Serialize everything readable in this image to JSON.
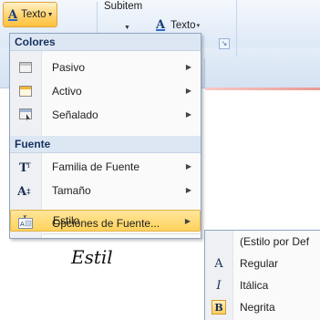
{
  "ribbon": {
    "texto_button_label": "Texto",
    "subitem_label": "Subitem",
    "texto2_label": "Texto"
  },
  "menu": {
    "sections": [
      {
        "header": "Colores",
        "items": [
          {
            "label": "Pasivo",
            "icon": "passive-color-icon"
          },
          {
            "label": "Activo",
            "icon": "active-color-icon"
          },
          {
            "label": "Señalado",
            "icon": "highlighted-color-icon"
          }
        ]
      },
      {
        "header": "Fuente",
        "items": [
          {
            "label": "Familia de Fuente",
            "icon": "font-family-icon"
          },
          {
            "label": "Tamaño",
            "icon": "font-size-icon"
          },
          {
            "label": "Estilo",
            "icon": "font-style-icon",
            "active": true
          }
        ]
      }
    ],
    "footer_item": {
      "label": "Opciones de Fuente...",
      "icon": "font-options-icon"
    }
  },
  "submenu": {
    "items": [
      {
        "label": "(Estilo por Def",
        "icon": ""
      },
      {
        "label": "Regular",
        "icon": "regular-a-icon"
      },
      {
        "label": "Itálica",
        "icon": "italic-i-icon"
      },
      {
        "label": "Negrita",
        "icon": "bold-b-icon"
      }
    ]
  },
  "caption": "Estil",
  "colors": {
    "highlight": "#ffd25c",
    "menu_border": "#8ea5c4",
    "header_bg": "#dde7f3",
    "header_text": "#15315f"
  }
}
